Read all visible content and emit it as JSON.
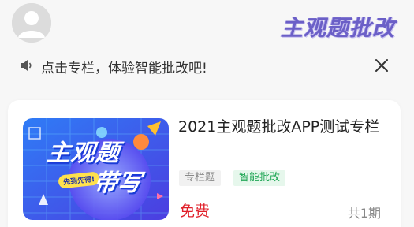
{
  "header": {
    "brand_title": "主观题批改"
  },
  "notice": {
    "text": "点击专栏，体验智能批改吧!"
  },
  "card": {
    "cover_title_line1": "主观题",
    "cover_title_line2": "带写",
    "cover_badge": "先到先得!",
    "title": "2021主观题批改APP测试专栏",
    "tags": [
      "专栏题",
      "智能批改"
    ],
    "price": "免费",
    "periods": "共1期"
  },
  "colors": {
    "brand_purple": "#6b5fc7",
    "price_red": "#e0202a",
    "tag_green": "#23a858",
    "cover_blue": "#2b5cf0"
  },
  "icons": {
    "avatar": "user-avatar-icon",
    "speaker": "speaker-icon",
    "close": "close-icon"
  }
}
